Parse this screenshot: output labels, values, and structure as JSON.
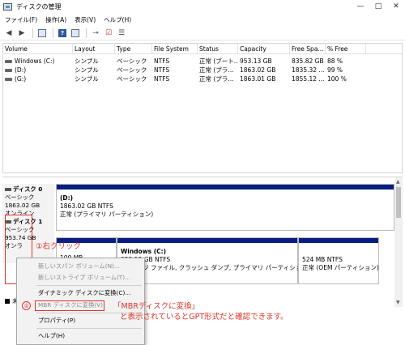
{
  "window": {
    "title": "ディスクの管理"
  },
  "window_controls": {
    "minimize": "—",
    "maximize": "□",
    "close": "✕"
  },
  "menu": [
    {
      "label": "ファイル(F)"
    },
    {
      "label": "操作(A)"
    },
    {
      "label": "表示(V)"
    },
    {
      "label": "ヘルプ(H)"
    }
  ],
  "toolbar": {
    "icons": [
      "back-arrow-icon",
      "forward-arrow-icon",
      "properties-icon",
      "help-icon",
      "properties-grid-icon",
      "connect-icon",
      "check-icon",
      "list-icon"
    ]
  },
  "volume_table": {
    "columns": [
      "Volume",
      "Layout",
      "Type",
      "File System",
      "Status",
      "Capacity",
      "Free Spa...",
      "% Free"
    ],
    "rows": [
      {
        "volume": "Windows (C:)",
        "layout": "シンプル",
        "type": "ベーシック",
        "fs": "NTFS",
        "status": "正常 (ブート...",
        "capacity": "953.13 GB",
        "free": "835.82 GB",
        "pct": "88 %"
      },
      {
        "volume": "(D:)",
        "layout": "シンプル",
        "type": "ベーシック",
        "fs": "NTFS",
        "status": "正常 (プラ...",
        "capacity": "1863.02 GB",
        "free": "1835.32 ...",
        "pct": "99 %"
      },
      {
        "volume": "(G:)",
        "layout": "シンプル",
        "type": "ベーシック",
        "fs": "NTFS",
        "status": "正常 (プラ...",
        "capacity": "1863.01 GB",
        "free": "1855.12 ...",
        "pct": "100 %"
      }
    ]
  },
  "disks": {
    "disk0": {
      "name": "ディスク 0",
      "type": "ベーシック",
      "size": "1863.02 GB",
      "state": "オンライン",
      "partition": {
        "name": "(D:)",
        "size": "1863.02 GB NTFS",
        "status": "正常 (プライマリ パーティション)"
      }
    },
    "disk1": {
      "name": "ディスク 1",
      "type": "ベーシック",
      "size": "953.74 GB",
      "state": "オンラ",
      "part_small_size": "100 MB",
      "windows": {
        "name": "Windows  (C:)",
        "size": "953.13 GB NTFS",
        "status": "ト, ページ ファイル, クラッシュ ダンプ, プライマリ パーティション)"
      },
      "oem": {
        "size": "524 MB NTFS",
        "status": "正常 (OEM パーティション)"
      }
    }
  },
  "legend": {
    "label": "未"
  },
  "context_menu": {
    "items": [
      {
        "label": "新しいスパン ボリューム(N)...",
        "disabled": true
      },
      {
        "label": "新しいストライプ ボリューム(T)...",
        "disabled": true
      },
      {
        "label": "ダイナミック ディスクに変換(C)...",
        "disabled": false
      },
      {
        "label": "MBR ディスクに変換(V)",
        "disabled": true
      },
      {
        "label": "プロパティ(P)",
        "disabled": false
      },
      {
        "label": "ヘルプ(H)",
        "disabled": false
      }
    ]
  },
  "annotations": {
    "step1": "①右クリック",
    "step2_badge": "②",
    "note_line1": "「MBRディスクに変換」",
    "note_line2": "と表示されているとGPT形式だと確認できます。",
    "color": "#e0332b"
  }
}
